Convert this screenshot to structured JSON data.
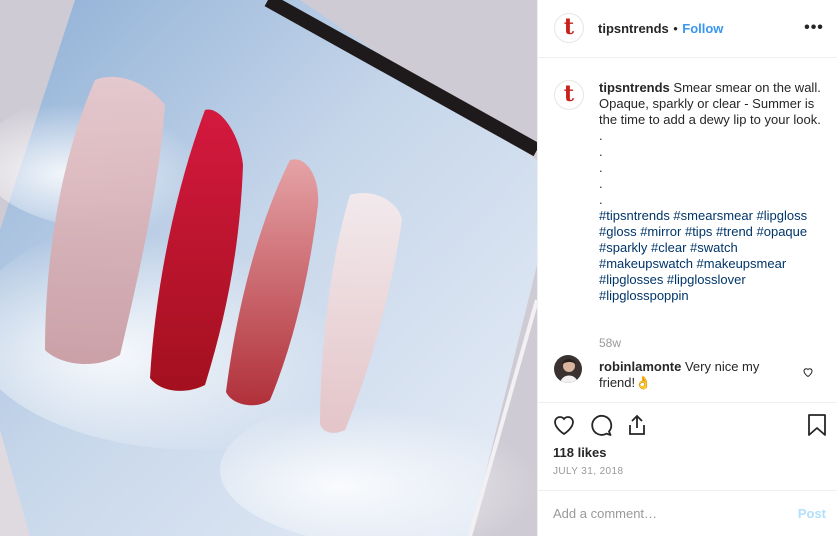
{
  "post": {
    "photo_description_icon": "lip-gloss-swatches-photo",
    "author": "tipsntrends",
    "avatar_letter": "t",
    "separator": "•",
    "follow_label": "Follow",
    "more_icon": "more-icon"
  },
  "caption": {
    "username": "tipsntrends",
    "text": "Smear smear on the wall. Opaque, sparkly or clear - Summer is the time to add a dewy lip to your look.",
    "dots": [
      ".",
      ".",
      ".",
      ".",
      "."
    ],
    "hashtags": "#tipsntrends #smearsmear #lipgloss #gloss #mirror #tips #trend #opaque #sparkly #clear #swatch #makeupswatch #makeupsmear #lipglosses #lipglosslover #lipglosspoppin",
    "age": "58w"
  },
  "comment": {
    "username": "robinlamonte",
    "text": "Very nice my friend!👌"
  },
  "actions": {
    "likes": "118 likes",
    "date": "JULY 31, 2018",
    "add_comment_placeholder": "Add a comment…",
    "post_label": "Post"
  },
  "colors": {
    "accent": "#3897f0",
    "text": "#262626",
    "muted": "#999999",
    "hashtag": "#003569",
    "brand_red": "#c8201b",
    "post_disabled": "#b2dffc"
  }
}
